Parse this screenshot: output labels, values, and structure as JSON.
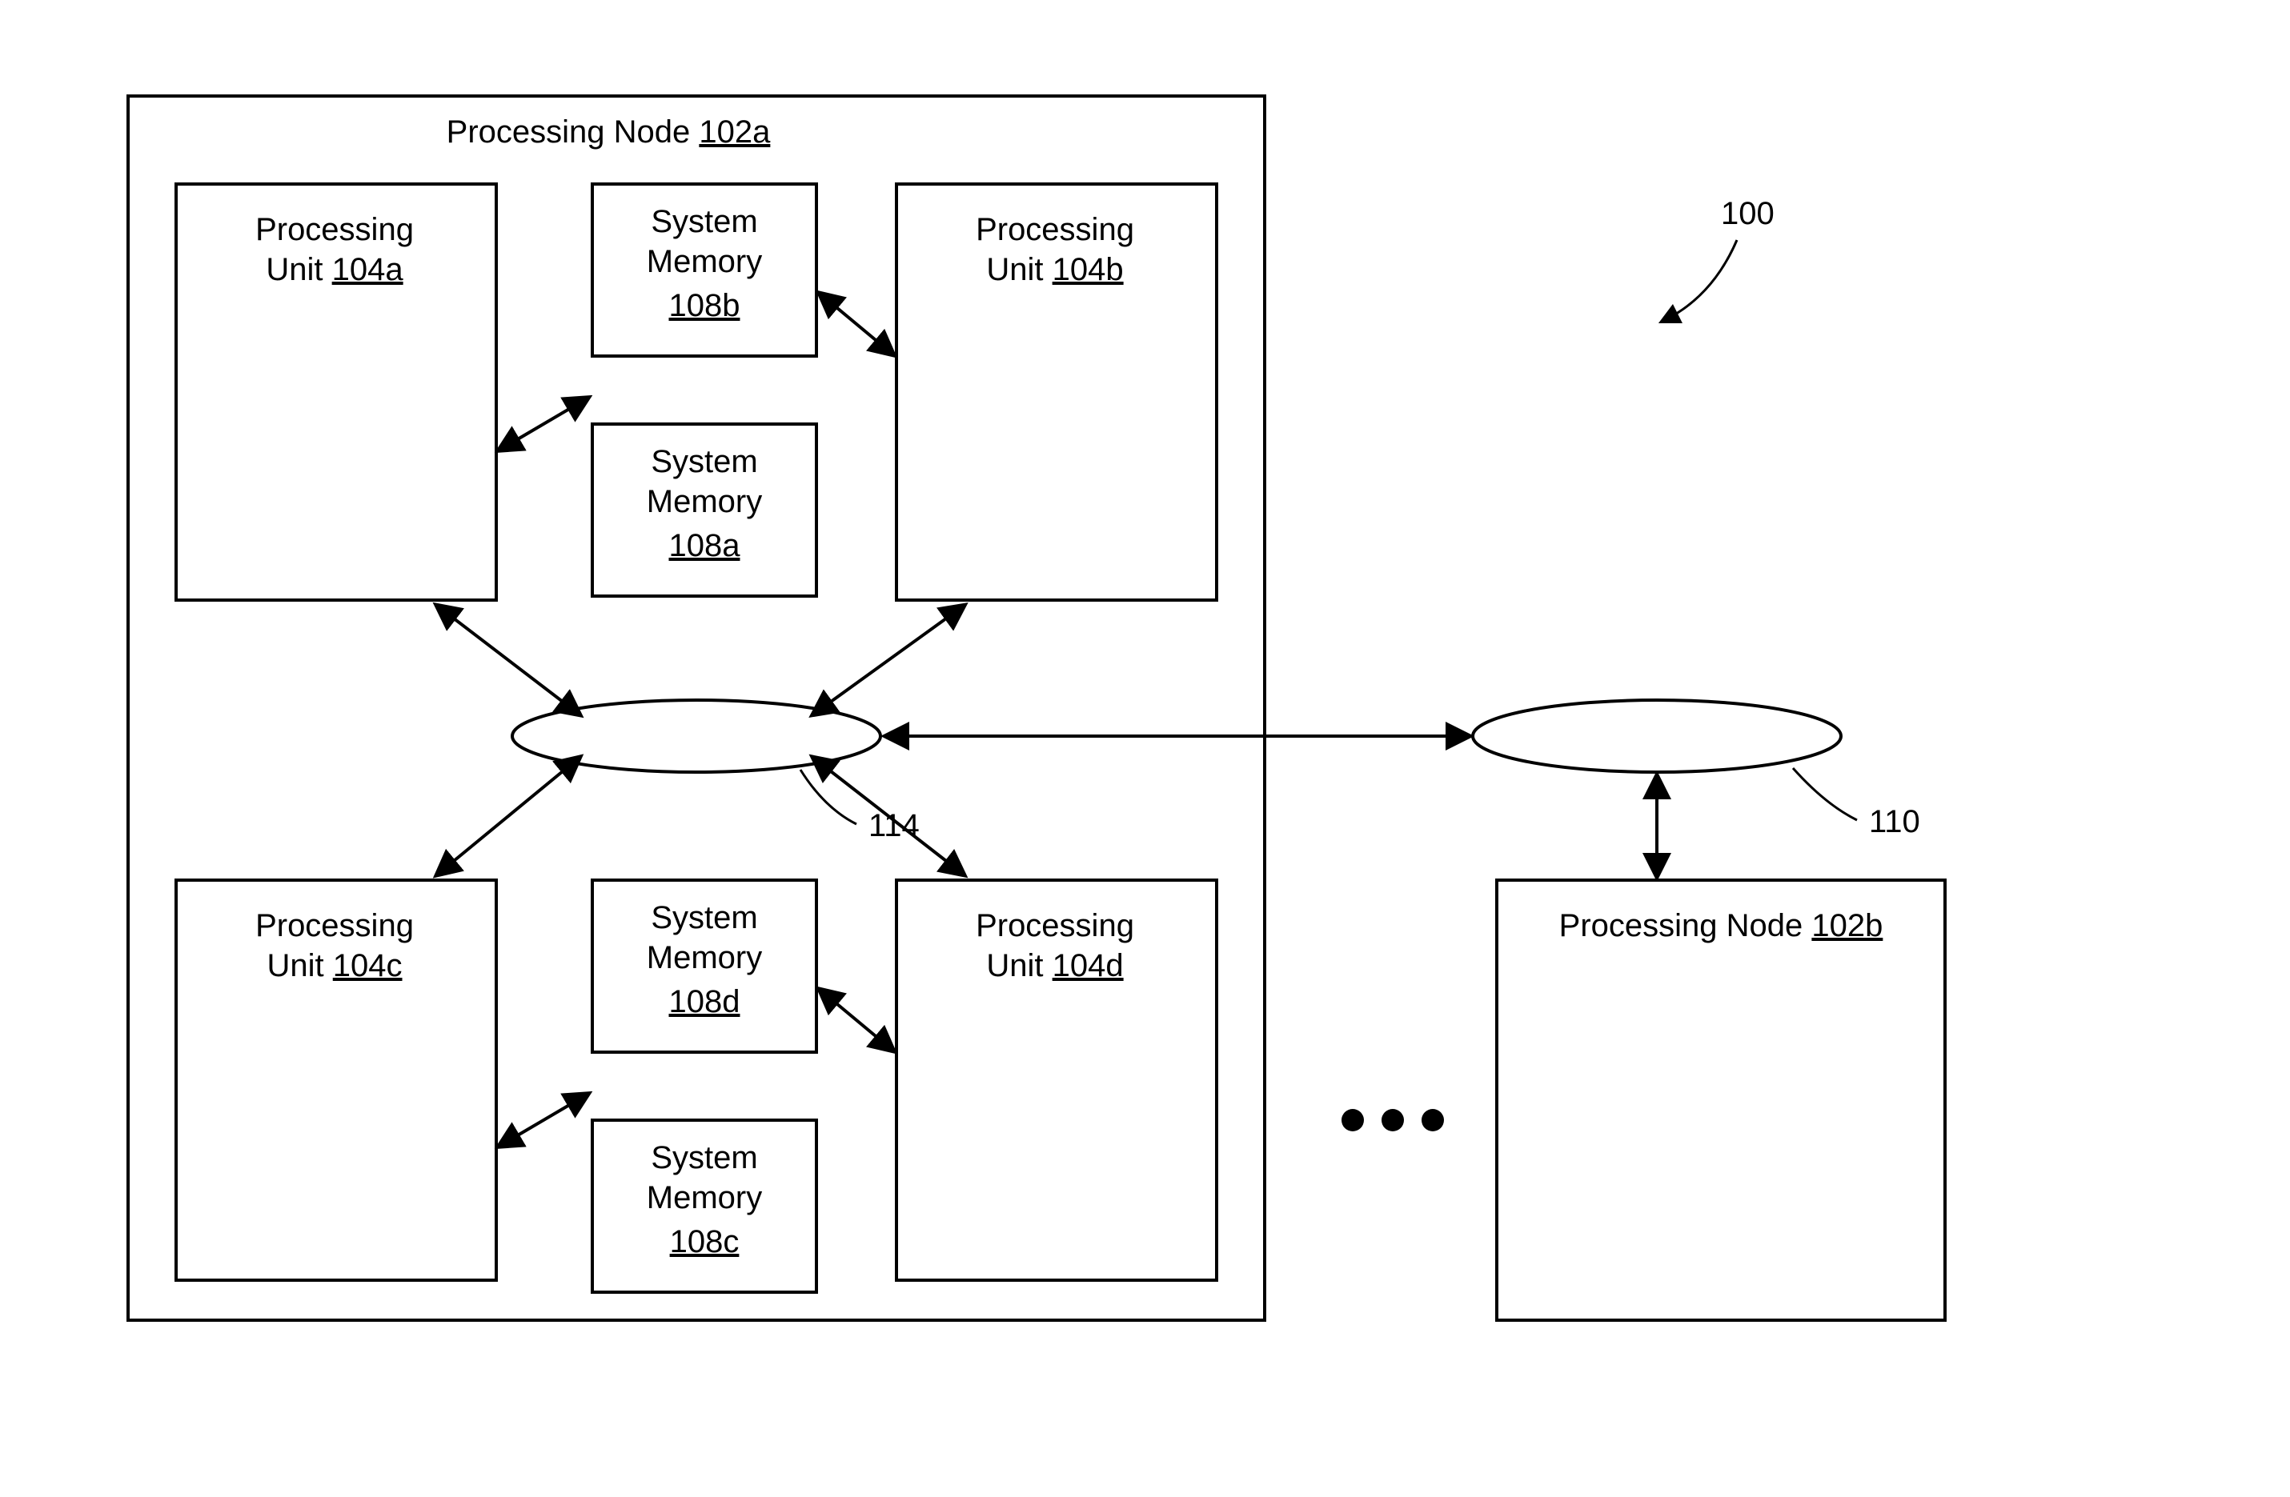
{
  "fig": {
    "ref": "100",
    "node_a": {
      "title_prefix": "Processing Node",
      "title_ref": "102a",
      "pu_a": {
        "line1": "Processing",
        "line2_prefix": "Unit",
        "ref": "104a"
      },
      "pu_b": {
        "line1": "Processing",
        "line2_prefix": "Unit",
        "ref": "104b"
      },
      "pu_c": {
        "line1": "Processing",
        "line2_prefix": "Unit",
        "ref": "104c"
      },
      "pu_d": {
        "line1": "Processing",
        "line2_prefix": "Unit",
        "ref": "104d"
      },
      "sm_a": {
        "line1": "System",
        "line2": "Memory",
        "ref": "108a"
      },
      "sm_b": {
        "line1": "System",
        "line2": "Memory",
        "ref": "108b"
      },
      "sm_c": {
        "line1": "System",
        "line2": "Memory",
        "ref": "108c"
      },
      "sm_d": {
        "line1": "System",
        "line2": "Memory",
        "ref": "108d"
      },
      "fabric_ref": "114"
    },
    "interconnect_ref": "110",
    "node_b": {
      "title_prefix": "Processing Node",
      "title_ref": "102b"
    }
  }
}
